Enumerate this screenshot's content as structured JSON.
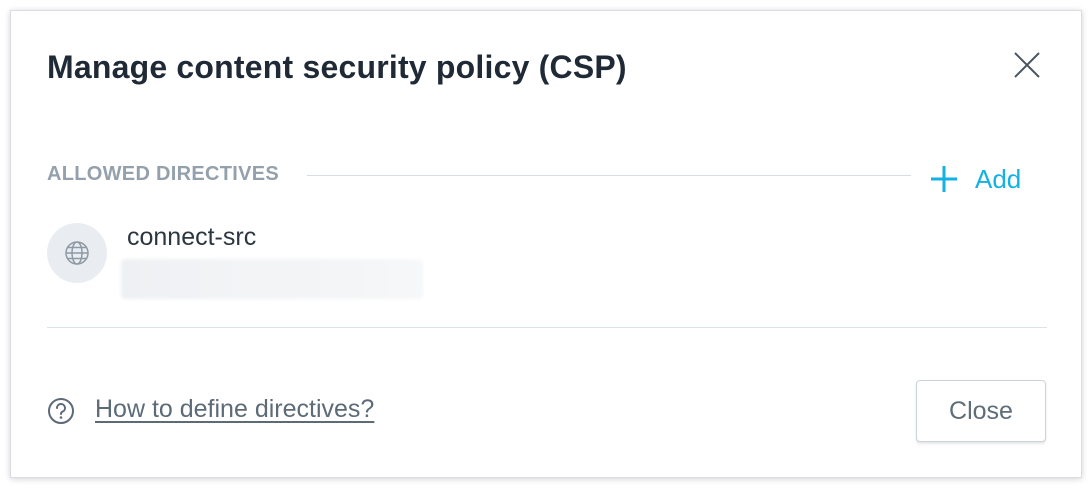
{
  "dialog": {
    "title": "Manage content security policy (CSP)",
    "close_icon": "close-icon"
  },
  "directives_section": {
    "label": "ALLOWED DIRECTIVES",
    "add_label": "Add",
    "add_icon": "plus-icon",
    "items": [
      {
        "icon": "globe-icon",
        "name": "connect-src",
        "value": ""
      }
    ]
  },
  "footer": {
    "help_icon": "question-circle-icon",
    "help_link": "How to define directives?",
    "close_label": "Close"
  },
  "colors": {
    "accent": "#14b2e2",
    "title_text": "#1f2a36",
    "muted_text": "#94a1ad",
    "divider": "#dde2e7"
  }
}
